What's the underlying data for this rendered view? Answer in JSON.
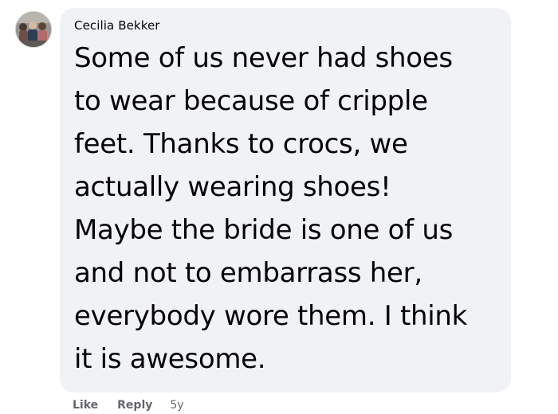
{
  "comment": {
    "author": "Cecilia Bekker",
    "lines": [
      "Some of us never had shoes",
      "to wear because of cripple",
      "feet. Thanks to crocs, we",
      "actually wearing shoes!",
      "Maybe the bride is one of us",
      "and not to embarrass her,",
      "everybody wore them. I think",
      "it is awesome."
    ]
  },
  "actions": {
    "like_label": "Like",
    "reply_label": "Reply",
    "timestamp": "5y"
  },
  "colors": {
    "bubble_background": "#f0f2f5",
    "text_primary": "#050505",
    "text_secondary": "#65676b"
  }
}
